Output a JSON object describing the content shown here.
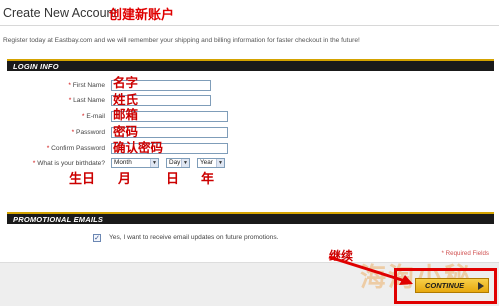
{
  "header": {
    "title": "Create New Account",
    "title_cn": "创建新账户",
    "intro": "Register today at Eastbay.com and we will remember your shipping and billing information for faster checkout in the future!"
  },
  "login_section": {
    "heading": "LOGIN INFO",
    "required_mark": "*",
    "fields": [
      {
        "label": "First Name",
        "value": "",
        "annotation": "名字"
      },
      {
        "label": "Last Name",
        "value": "",
        "annotation": "姓氏"
      },
      {
        "label": "E-mail",
        "value": "",
        "annotation": "邮箱"
      },
      {
        "label": "Password",
        "value": "",
        "annotation": "密码"
      },
      {
        "label": "Confirm Password",
        "value": "",
        "annotation": "确认密码"
      }
    ],
    "birthdate": {
      "label": "What is your birthdate?",
      "month": "Month",
      "day": "Day",
      "year": "Year",
      "annotation": "生日",
      "month_cn": "月",
      "day_cn": "日",
      "year_cn": "年"
    }
  },
  "promo_section": {
    "heading": "PROMOTIONAL EMAILS",
    "checkbox_checked": true,
    "checkbox_label": "Yes, I want to receive email updates on future promotions."
  },
  "footer": {
    "required_note": "* Required Fields",
    "continue_label": "CONTINUE",
    "continue_cn": "继续",
    "watermark": "海淘小秘"
  },
  "colors": {
    "annotation_red": "#cc0000",
    "section_bar": "#1a1a1a",
    "section_accent": "#d4a300",
    "button_gold": "#e7a80e"
  }
}
